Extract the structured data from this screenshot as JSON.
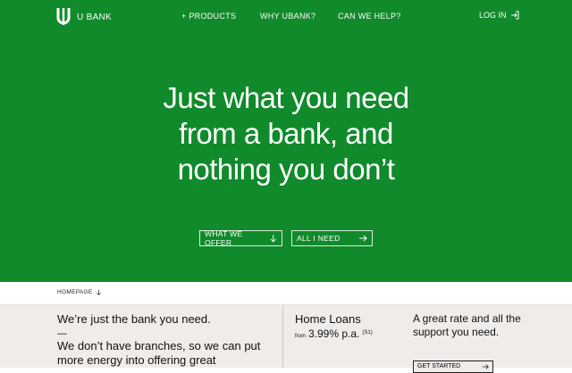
{
  "brand": {
    "name": "U BANK"
  },
  "nav": {
    "products": "+ PRODUCTS",
    "why": "WHY UBANK?",
    "help": "CAN WE HELP?",
    "login": "LOG IN"
  },
  "hero": {
    "headline_lines": [
      "Just what you need",
      "from a bank, and",
      "nothing you don’t"
    ],
    "btn_offer": "WHAT WE OFFER",
    "btn_all": "ALL I NEED"
  },
  "breadcrumb": {
    "label": "HOMEPAGE"
  },
  "intro": {
    "title": "We’re just the bank you need.",
    "dash": "—",
    "body": "We don’t have branches, so we can put more energy into offering great"
  },
  "loans": {
    "title": "Home Loans",
    "prefix": "from",
    "rate": "3.99% p.a.",
    "note": "(S1)"
  },
  "support": {
    "text": "A great rate and all the support you need.",
    "cta": "GET STARTED"
  },
  "colors": {
    "hero_bg": "#118a2b",
    "content_bg": "#efecea"
  }
}
